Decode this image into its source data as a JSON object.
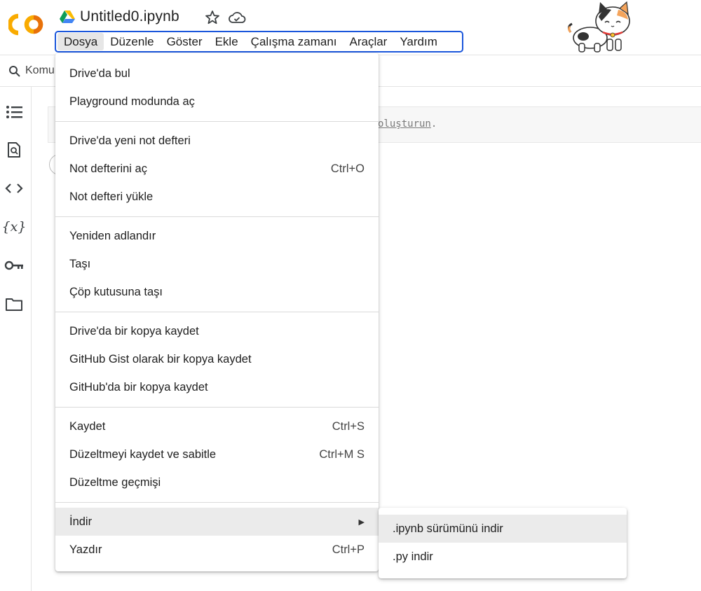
{
  "header": {
    "logo_text": "CO",
    "notebook_title": "Untitled0.ipynb",
    "icons": [
      "drive-icon",
      "star-icon",
      "cloud-icon"
    ]
  },
  "menubar": {
    "items": [
      "Dosya",
      "Düzenle",
      "Göster",
      "Ekle",
      "Çalışma zamanı",
      "Araçlar",
      "Yardım"
    ],
    "active": "Dosya"
  },
  "toolbar": {
    "label": "Komu"
  },
  "left_rail": {
    "icons": [
      "table-of-contents-icon",
      "find-icon",
      "code-snippets-icon",
      "variables-icon",
      "secrets-key-icon",
      "files-folder-icon"
    ],
    "variables_glyph": "{x}"
  },
  "cell": {
    "hint_text": "oluşturun",
    "hint_suffix": "."
  },
  "file_menu": {
    "items": [
      {
        "label": "Drive'da bul",
        "shortcut": ""
      },
      {
        "label": "Playground modunda aç",
        "shortcut": ""
      },
      {
        "label": "Drive'da yeni not defteri",
        "shortcut": ""
      },
      {
        "label": "Not defterini aç",
        "shortcut": "Ctrl+O"
      },
      {
        "label": "Not defteri yükle",
        "shortcut": ""
      },
      {
        "label": "Yeniden adlandır",
        "shortcut": ""
      },
      {
        "label": "Taşı",
        "shortcut": ""
      },
      {
        "label": "Çöp kutusuna taşı",
        "shortcut": ""
      },
      {
        "label": "Drive'da bir kopya kaydet",
        "shortcut": ""
      },
      {
        "label": "GitHub Gist olarak bir kopya kaydet",
        "shortcut": ""
      },
      {
        "label": "GitHub'da bir kopya kaydet",
        "shortcut": ""
      },
      {
        "label": "Kaydet",
        "shortcut": "Ctrl+S"
      },
      {
        "label": "Düzeltmeyi kaydet ve sabitle",
        "shortcut": "Ctrl+M S"
      },
      {
        "label": "Düzeltme geçmişi",
        "shortcut": ""
      },
      {
        "label": "İndir",
        "shortcut": "▶"
      },
      {
        "label": "Yazdır",
        "shortcut": "Ctrl+P"
      }
    ],
    "highlighted": "İndir"
  },
  "download_submenu": {
    "items": [
      ".ipynb sürümünü indir",
      ".py indir"
    ],
    "highlighted": ".ipynb sürümünü indir"
  },
  "colors": {
    "menubar_border": "#1a56db",
    "logo_orange": "#f9ab00",
    "logo_dark_orange": "#e8710a",
    "menu_highlight": "#ebebeb"
  }
}
